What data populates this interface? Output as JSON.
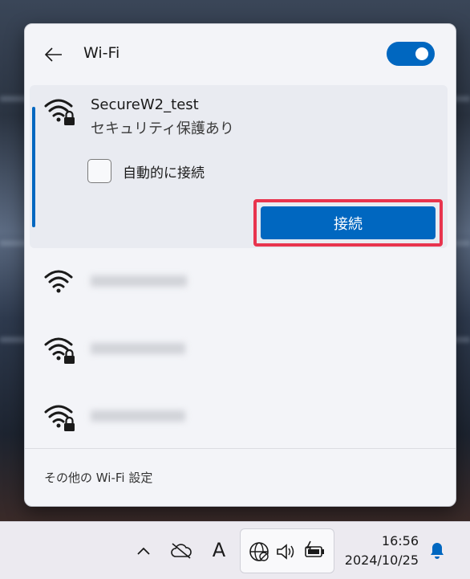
{
  "header": {
    "title": "Wi-Fi",
    "wifi_enabled": true
  },
  "networks": [
    {
      "ssid": "SecureW2_test",
      "security": "セキュリティ保護あり",
      "secured": true,
      "expanded": true,
      "auto_connect_label": "自動的に接続",
      "auto_connect_checked": false,
      "connect_label": "接続"
    },
    {
      "ssid": "",
      "secured": false,
      "blurred": true
    },
    {
      "ssid": "",
      "secured": true,
      "blurred": true
    },
    {
      "ssid": "",
      "secured": true,
      "blurred": true
    }
  ],
  "footer": {
    "more_settings": "その他の Wi-Fi 設定"
  },
  "taskbar": {
    "input_indicator": "A",
    "time": "16:56",
    "date": "2024/10/25"
  },
  "colors": {
    "accent": "#0067c0",
    "highlight_border": "#e8344e"
  }
}
